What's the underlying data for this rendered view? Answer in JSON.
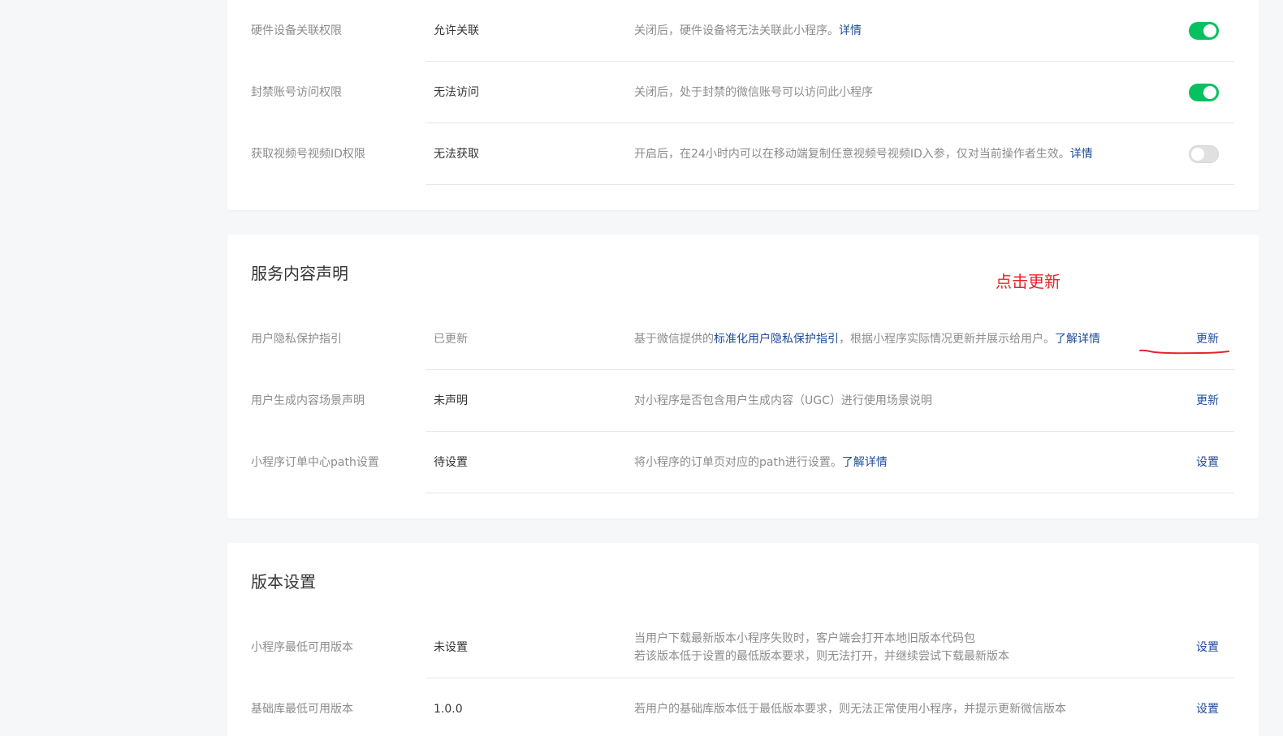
{
  "permissions": {
    "rows": [
      {
        "label": "硬件设备关联权限",
        "status": "允许关联",
        "desc": "关闭后，硬件设备将无法关联此小程序。",
        "link": "详情",
        "toggle": "on"
      },
      {
        "label": "封禁账号访问权限",
        "status": "无法访问",
        "desc": "关闭后，处于封禁的微信账号可以访问此小程序",
        "toggle": "on"
      },
      {
        "label": "获取视频号视频ID权限",
        "status": "无法获取",
        "desc": "开启后，在24小时内可以在移动端复制任意视频号视频ID入参，仅对当前操作者生效。",
        "link": "详情",
        "toggle": "off"
      }
    ]
  },
  "service": {
    "title": "服务内容声明",
    "annotation": "点击更新",
    "rows": [
      {
        "label": "用户隐私保护指引",
        "status": "已更新",
        "desc_pre": "基于微信提供的",
        "desc_link": "标准化用户隐私保护指引",
        "desc_post": "，根据小程序实际情况更新并展示给用户。",
        "link": "了解详情",
        "action": "更新"
      },
      {
        "label": "用户生成内容场景声明",
        "status": "未声明",
        "desc": "对小程序是否包含用户生成内容（UGC）进行使用场景说明",
        "action": "更新"
      },
      {
        "label": "小程序订单中心path设置",
        "status": "待设置",
        "desc": "将小程序的订单页对应的path进行设置。",
        "link": "了解详情",
        "action": "设置"
      }
    ]
  },
  "version": {
    "title": "版本设置",
    "rows": [
      {
        "label": "小程序最低可用版本",
        "status": "未设置",
        "desc_line1": "当用户下载最新版本小程序失败时，客户端会打开本地旧版本代码包",
        "desc_line2": "若该版本低于设置的最低版本要求，则无法打开，并继续尝试下载最新版本",
        "action": "设置"
      },
      {
        "label": "基础库最低可用版本",
        "status": "1.0.0",
        "desc": "若用户的基础库版本低于最低版本要求，则无法正常使用小程序，并提示更新微信版本",
        "action": "设置"
      }
    ]
  },
  "colors": {
    "accent_link": "#1e4b9b",
    "toggle_on": "#07c160",
    "annotation_red": "#e8242b"
  }
}
